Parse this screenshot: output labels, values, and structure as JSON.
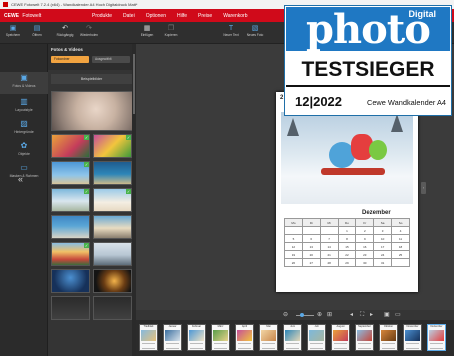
{
  "window": {
    "title": "CEWE Fotowelt 7.2.4 (x64) - Wandkalender A4 Hoch Digitaldruck Matt*"
  },
  "menubar": {
    "brand_cewe": "CEWE",
    "brand_name": "Fotowelt",
    "items": [
      "Produkte",
      "Datei",
      "Optionen",
      "Hilfe",
      "Preise",
      "Warenkorb"
    ],
    "accent_color": "#d00a1a"
  },
  "toolbar": {
    "buttons": [
      {
        "label": "Speichern",
        "icon": "save-icon"
      },
      {
        "label": "Öffnen",
        "icon": "folder-icon"
      },
      {
        "label": "Rückgängig",
        "icon": "undo-icon"
      },
      {
        "label": "Wiederholen",
        "icon": "redo-icon"
      },
      {
        "label": "Einfügen",
        "icon": "paste-icon"
      },
      {
        "label": "Kopieren",
        "icon": "copy-icon"
      },
      {
        "label": "Neuer Text",
        "icon": "text-icon"
      },
      {
        "label": "Neues Foto",
        "icon": "photo-icon"
      }
    ]
  },
  "leftnav": {
    "items": [
      {
        "label": "Fotos & Videos",
        "icon": "photos-icon"
      },
      {
        "label": "Layoutstyle",
        "icon": "layout-icon"
      },
      {
        "label": "Hintergründe",
        "icon": "background-icon"
      },
      {
        "label": "Objekte",
        "icon": "objects-icon"
      },
      {
        "label": "Masken & Rahmen",
        "icon": "mask-icon"
      }
    ],
    "collapse_symbol": "«"
  },
  "panel": {
    "title": "Fotos & Videos",
    "chip_left": "Fotoordner",
    "chip_right": "Ausgewählt",
    "folder": "Beispielbilder"
  },
  "calendar": {
    "month": "Dezember",
    "page_number": "2",
    "weekdays": [
      "Mo",
      "Di",
      "Mi",
      "Do",
      "Fr",
      "Sa",
      "So"
    ],
    "weeks": [
      [
        "",
        "",
        "",
        "1",
        "2",
        "3",
        "4"
      ],
      [
        "5",
        "6",
        "7",
        "8",
        "9",
        "10",
        "11"
      ],
      [
        "12",
        "13",
        "14",
        "15",
        "16",
        "17",
        "18"
      ],
      [
        "19",
        "20",
        "21",
        "22",
        "23",
        "24",
        "25"
      ],
      [
        "26",
        "27",
        "28",
        "29",
        "30",
        "31",
        ""
      ]
    ]
  },
  "filmstrip": {
    "months": [
      "Titelblatt",
      "Januar",
      "Februar",
      "März",
      "April",
      "Mai",
      "Juni",
      "Juli",
      "August",
      "September",
      "Oktober",
      "November",
      "Dezember"
    ]
  },
  "badge": {
    "digital": "Digital",
    "photo": "photo",
    "testsieger": "TESTSIEGER",
    "issue": "12|2022",
    "product": "Cewe Wandkalender A4",
    "brand_color": "#1f78c3"
  }
}
